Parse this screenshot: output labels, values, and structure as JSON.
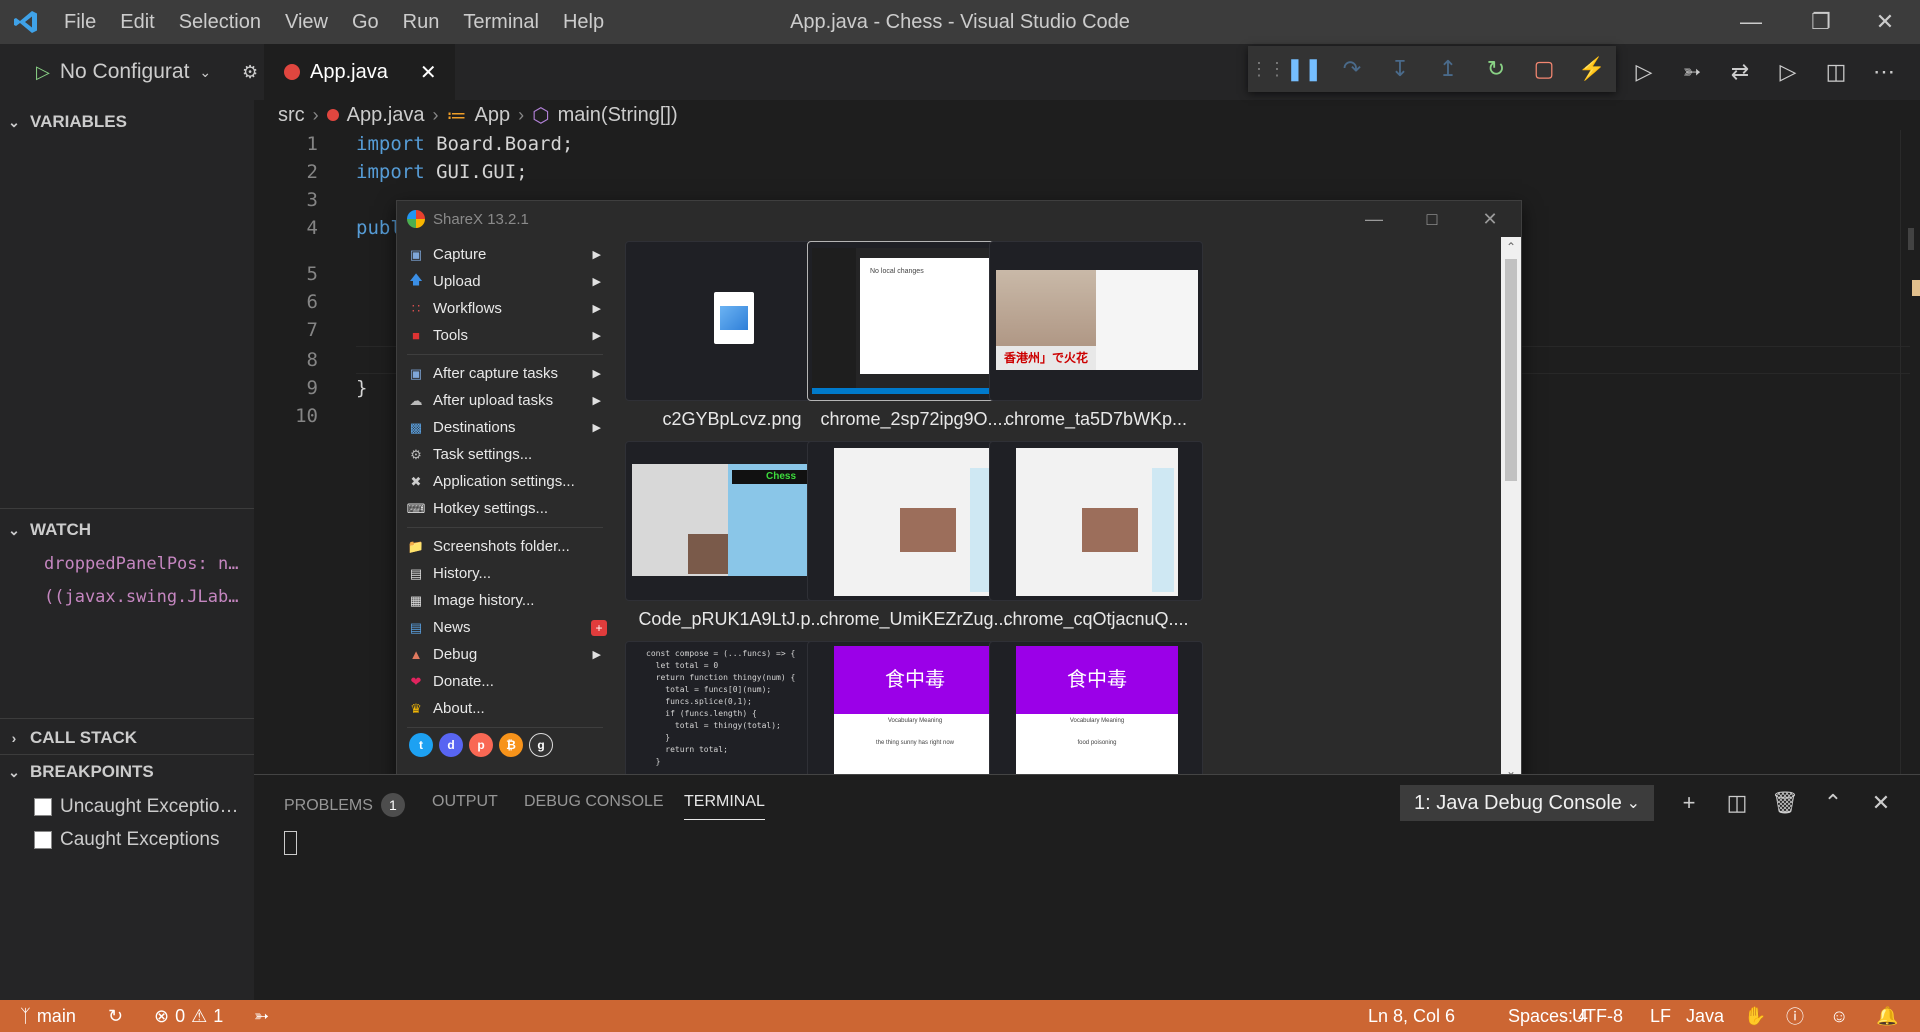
{
  "app": {
    "title": "App.java - Chess - Visual Studio Code",
    "menu": [
      "File",
      "Edit",
      "Selection",
      "View",
      "Go",
      "Run",
      "Terminal",
      "Help"
    ]
  },
  "sidebar": {
    "run_config": "No Configurat",
    "variables_label": "VARIABLES",
    "watch_label": "WATCH",
    "watch_items": [
      "droppedPanelPos: n…",
      "((javax.swing.JLab…"
    ],
    "call_stack_label": "CALL STACK",
    "breakpoints_label": "BREAKPOINTS",
    "breakpoints": [
      "Uncaught Exceptio…",
      "Caught Exceptions"
    ]
  },
  "editor": {
    "tab_label": "App.java",
    "breadcrumb": [
      "src",
      "App.java",
      "App",
      "main(String[])"
    ],
    "lines": [
      {
        "num": "1",
        "kw": "import",
        "rest": " Board.Board;"
      },
      {
        "num": "2",
        "kw": "import",
        "rest": " GUI.GUI;"
      },
      {
        "num": "3",
        "kw": "",
        "rest": ""
      },
      {
        "num": "4",
        "kw": "publ",
        "rest": ""
      },
      {
        "num": "5",
        "kw": "",
        "rest": ""
      },
      {
        "num": "6",
        "kw": "",
        "rest": ""
      },
      {
        "num": "7",
        "kw": "",
        "rest": ""
      },
      {
        "num": "8",
        "kw": "",
        "rest": ""
      },
      {
        "num": "9",
        "kw": "",
        "rest": "}"
      },
      {
        "num": "10",
        "kw": "",
        "rest": ""
      }
    ]
  },
  "sharex": {
    "title": "ShareX 13.2.1",
    "menu": [
      {
        "label": "Capture",
        "icon": "capture-icon",
        "submenu": true
      },
      {
        "label": "Upload",
        "icon": "upload-icon",
        "submenu": true
      },
      {
        "label": "Workflows",
        "icon": "workflows-icon",
        "submenu": true
      },
      {
        "label": "Tools",
        "icon": "tools-icon",
        "submenu": true
      },
      {
        "label": "After capture tasks",
        "icon": "after-capture-icon",
        "submenu": true
      },
      {
        "label": "After upload tasks",
        "icon": "after-upload-icon",
        "submenu": true
      },
      {
        "label": "Destinations",
        "icon": "destinations-icon",
        "submenu": true
      },
      {
        "label": "Task settings...",
        "icon": "gear-icon",
        "submenu": false
      },
      {
        "label": "Application settings...",
        "icon": "wrench-icon",
        "submenu": false
      },
      {
        "label": "Hotkey settings...",
        "icon": "keyboard-icon",
        "submenu": false
      },
      {
        "label": "Screenshots folder...",
        "icon": "folder-icon",
        "submenu": false
      },
      {
        "label": "History...",
        "icon": "history-icon",
        "submenu": false
      },
      {
        "label": "Image history...",
        "icon": "image-history-icon",
        "submenu": false
      },
      {
        "label": "News",
        "icon": "news-icon",
        "submenu": false
      },
      {
        "label": "Debug",
        "icon": "debug-icon",
        "submenu": true
      },
      {
        "label": "Donate...",
        "icon": "heart-icon",
        "submenu": false
      },
      {
        "label": "About...",
        "icon": "crown-icon",
        "submenu": false
      }
    ],
    "thumbnails": [
      {
        "name": "c2GYBpLcvz.png"
      },
      {
        "name": "chrome_2sp72ipg9O...."
      },
      {
        "name": "chrome_ta5D7bWKp..."
      },
      {
        "name": "Code_pRUK1A9LtJ.p..."
      },
      {
        "name": "chrome_UmiKEZrZug..."
      },
      {
        "name": "chrome_cqOtjacnuQ...."
      }
    ],
    "thumb_text": {
      "chess": "Chess",
      "kanji1": "食中毒",
      "kanji2": "食中毒",
      "vocab1": "Vocabulary Meaning",
      "vocab2": "Vocabulary Meaning",
      "meaning1": "the thing sunny has right now",
      "meaning2": "food poisoning",
      "nolocal": "No local changes",
      "news_banner": "香港州」で火花",
      "code_snippet": [
        "const compose = (...funcs) => {",
        "  let total = 0",
        "  return function thingy(num) {",
        "    total = funcs[0](num);",
        "    funcs.splice(0,1);",
        "    if (funcs.length) {",
        "      total = thingy(total);",
        "    }",
        "    return total;",
        "  }"
      ]
    }
  },
  "panel": {
    "tabs": [
      "PROBLEMS",
      "OUTPUT",
      "DEBUG CONSOLE",
      "TERMINAL"
    ],
    "problems_count": "1",
    "terminal_select": "1: Java Debug Console"
  },
  "statusbar": {
    "branch": "main",
    "errors": "0",
    "warnings": "1",
    "position": "Ln 8, Col 6",
    "spaces": "Spaces: 4",
    "encoding": "UTF-8",
    "eol": "LF",
    "language": "Java"
  },
  "colors": {
    "statusbar": "#cc6633",
    "accent_keyword": "#569cd6"
  }
}
